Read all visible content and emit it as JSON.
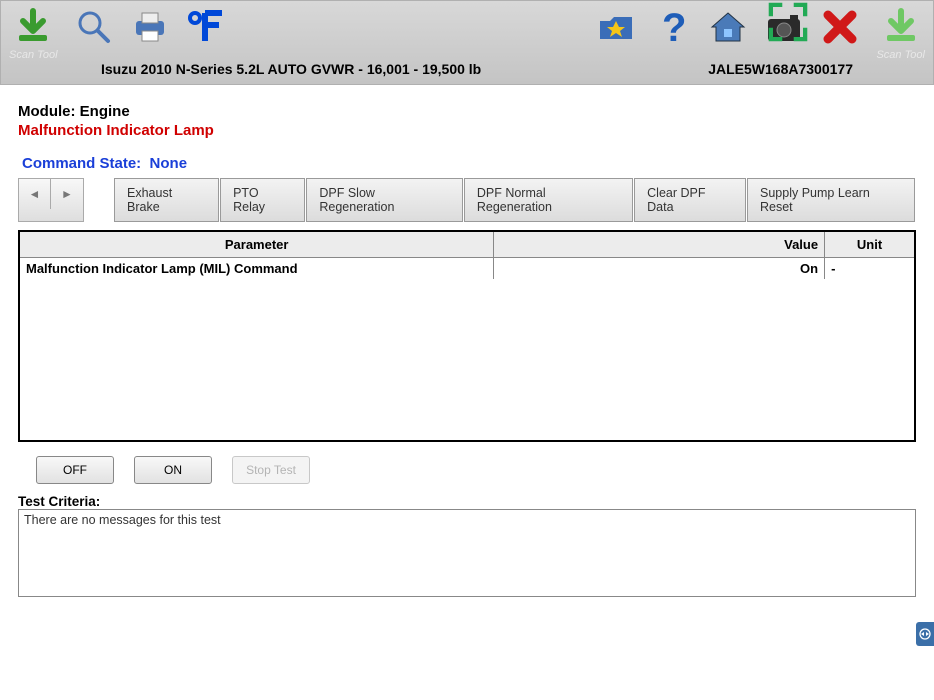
{
  "toolbar": {
    "scan_left_label": "Scan Tool",
    "scan_right_label": "Scan Tool"
  },
  "vehicle": "Isuzu  2010  N-Series  5.2L  AUTO GVWR - 16,001 - 19,500 lb",
  "vin": "JALE5W168A7300177",
  "module_label": "Module: Engine",
  "fault_label": "Malfunction Indicator Lamp",
  "command_state_label": "Command State:",
  "command_state_value": "None",
  "tabs": [
    "Exhaust Brake",
    "PTO Relay",
    "DPF Slow Regeneration",
    "DPF Normal Regeneration",
    "Clear DPF Data",
    "Supply Pump Learn Reset"
  ],
  "table": {
    "headers": [
      "Parameter",
      "Value",
      "Unit"
    ],
    "rows": [
      {
        "param": "Malfunction Indicator Lamp (MIL) Command",
        "value": "On",
        "unit": "-"
      }
    ]
  },
  "buttons": {
    "off": "OFF",
    "on": "ON",
    "stop": "Stop Test"
  },
  "criteria_label": "Test Criteria:",
  "criteria_text": "There are no messages for this test"
}
